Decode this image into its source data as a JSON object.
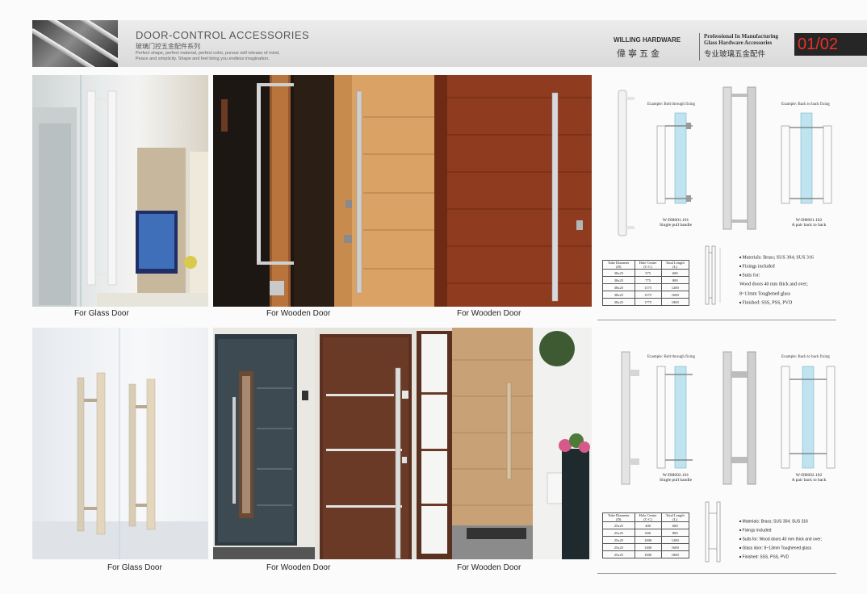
{
  "header": {
    "title": "DOOR-CONTROL ACCESSORIES",
    "subtitle_cn": "玻璃门控五金配件系列",
    "tagline_1": "Perfect shape, perfect material, perfect color, pursue self release of mind,",
    "tagline_2": "Peace and simplicity. Shape and feel bring you endless imagination.",
    "brand_en": "WILLING HARDWARE",
    "brand_cn": "偉寧五金",
    "pro_line_1": "Professional In Manufacturing",
    "pro_line_2": "Glass Hardware Accessories",
    "pro_cn": "专业玻璃五金配件",
    "page_number": "01/02"
  },
  "captions": {
    "r1_c1": "For Glass Door",
    "r1_c2": "For Wooden Door",
    "r1_c3": "For Wooden Door",
    "r2_c1": "For Glass Door",
    "r2_c2": "For Wooden Door",
    "r2_c3": "For Wooden Door"
  },
  "spec1": {
    "ex_through": "Example: Bolt through fixing",
    "ex_back": "Example: Back to back fixing",
    "model_a": "W-DH601.101",
    "model_a_desc": "Single pull handle",
    "model_b": "W-DH601.102",
    "model_b_desc": "A pair back to back",
    "table": {
      "headers": [
        [
          "Tube Diameter",
          "(D)"
        ],
        [
          "Hole Center",
          "(C-C)"
        ],
        [
          "Total Length",
          "(L)"
        ]
      ],
      "rows": [
        [
          "38x25",
          "575",
          "600"
        ],
        [
          "38x25",
          "775",
          "800"
        ],
        [
          "38x25",
          "1175",
          "1200"
        ],
        [
          "38x25",
          "1575",
          "1600"
        ],
        [
          "38x25",
          "1775",
          "1800"
        ]
      ]
    },
    "features": [
      "Materials: Brass; SUS 304; SUS 316",
      "Fixings  included",
      "Suits for:",
      "Wood doors 40 mm thick and over;",
      "8~13mm Toughened glass",
      "Finished: SSS, PSS, PVD"
    ]
  },
  "spec2": {
    "ex_through": "Example: Bolt through fixing",
    "ex_back": "Example: Back to back fixing",
    "model_a": "W-DH602.101",
    "model_a_desc": "Single pull handle",
    "model_b": "W-DH602.102",
    "model_b_desc": "A pair back to back",
    "table": {
      "headers": [
        [
          "Tube Diameter",
          "(D)"
        ],
        [
          "Hole Center",
          "(C-C)"
        ],
        [
          "Total Length",
          "(L)"
        ]
      ],
      "rows": [
        [
          "25x25",
          "400",
          "600"
        ],
        [
          "25x25",
          "600",
          "800"
        ],
        [
          "25x25",
          "1000",
          "1200"
        ],
        [
          "25x25",
          "1400",
          "1600"
        ],
        [
          "25x25",
          "1600",
          "1800"
        ]
      ]
    },
    "features": [
      "Materials: Brass; SUS 304; SUS 316",
      "Fixings  included",
      "Suits for: Wood doors 40 mm thick and over;",
      "Glass door: 8~13mm Toughened glass",
      "Finished: SSS, PSS, PVD"
    ]
  },
  "colors": {
    "page_number": "#e8322a",
    "page_number_bg": "#262626",
    "wood_red": "#8e3b1f",
    "wood_light": "#cfa46c",
    "glass_blue": "#bfe3ef"
  }
}
